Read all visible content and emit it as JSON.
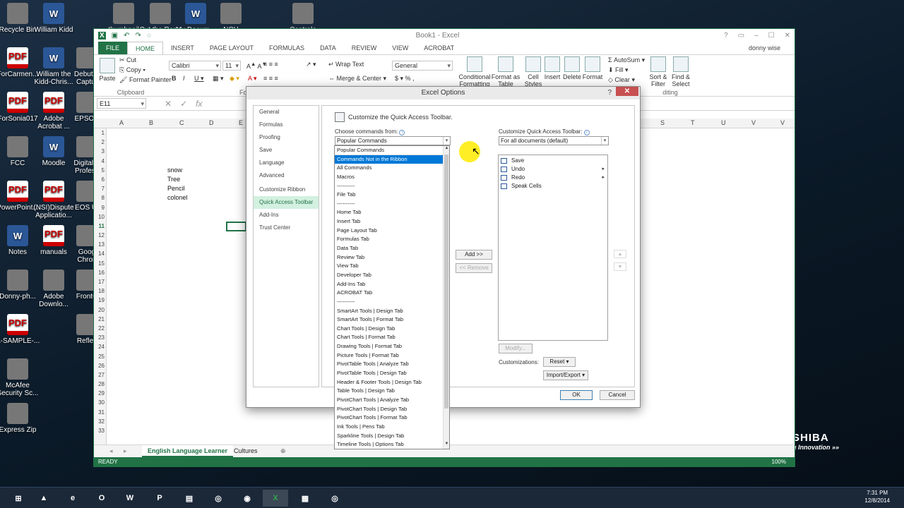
{
  "desktop": {
    "icons_left": [
      {
        "label": "Recycle Bin",
        "icon": "recycle-bin-icon"
      },
      {
        "label": "ForCarmen...",
        "icon": "pdf-icon"
      },
      {
        "label": "ForSonia017",
        "icon": "pdf-icon"
      },
      {
        "label": "FCC",
        "icon": "settings-icon"
      },
      {
        "label": "PowerPoint...",
        "icon": "pdf-icon"
      },
      {
        "label": "Notes",
        "icon": "word-icon"
      },
      {
        "label": "Donny-ph...",
        "icon": "image-icon"
      },
      {
        "label": "A-SAMPLE-...",
        "icon": "pdf-icon"
      },
      {
        "label": "McAfee",
        "label2": "Security Sc...",
        "icon": "mcafee-icon"
      },
      {
        "label": "Express Zip",
        "icon": "zip-icon"
      }
    ],
    "icons_col2": [
      {
        "label": "William Kidd",
        "icon": "word-icon"
      },
      {
        "label": "William the",
        "label2": "Kidd-Chris...",
        "icon": "word-icon"
      },
      {
        "label": "Adobe",
        "label2": "Acrobat ...",
        "icon": "pdf-icon"
      },
      {
        "label": "Moodle",
        "icon": "word-icon"
      },
      {
        "label": "(NSI)Dispute",
        "label2": "Applicatio...",
        "icon": "pdf-icon"
      },
      {
        "label": "manuals",
        "icon": "pdf-icon"
      },
      {
        "label": "Adobe",
        "label2": "Downlo...",
        "icon": "adobe-icon"
      }
    ],
    "icons_col3": [
      {
        "label": "Debut V",
        "label2": "Captur",
        "icon": "app-icon"
      },
      {
        "label": "EPSON",
        "icon": "printer-icon"
      },
      {
        "label": "Digital P",
        "label2": "Profess",
        "icon": "app-icon"
      },
      {
        "label": "EOS Ut",
        "icon": "camera-icon"
      },
      {
        "label": "Goog",
        "label2": "Chron",
        "icon": "chrome-icon"
      },
      {
        "label": "FrontC",
        "icon": "app-icon"
      },
      {
        "label": "Reflec",
        "icon": "app-icon"
      }
    ],
    "icons_top": [
      {
        "label": "thumbnail",
        "icon": "app-icon"
      },
      {
        "label": "Cut the Rope",
        "icon": "game-icon"
      },
      {
        "label": "My Docum...",
        "icon": "word-icon"
      },
      {
        "label": "NCH",
        "icon": "app-icon"
      },
      {
        "label": "Centrale",
        "icon": "app-icon"
      }
    ],
    "toshiba": {
      "brand": "SHIBA",
      "tagline": "g Innovation »»"
    }
  },
  "excel": {
    "title": "Book1 - Excel",
    "user": "donny wise",
    "tabs": [
      "FILE",
      "HOME",
      "INSERT",
      "PAGE LAYOUT",
      "FORMULAS",
      "DATA",
      "REVIEW",
      "VIEW",
      "ACROBAT"
    ],
    "ribbon": {
      "paste": "Paste",
      "cut": "Cut",
      "copy": "Copy",
      "format_painter": "Format Painter",
      "clipboard": "Clipboard",
      "font_name": "Calibri",
      "font_size": "11",
      "font_group": "Font",
      "wrap_text": "Wrap Text",
      "merge_center": "Merge & Center",
      "number_format": "General",
      "conditional_formatting": "Conditional Formatting",
      "format_as_table": "Format as Table",
      "cell_styles": "Cell Styles",
      "insert": "Insert",
      "delete": "Delete",
      "format": "Format",
      "autosum": "AutoSum",
      "fill": "Fill",
      "clear": "Clear",
      "sort_filter": "Sort & Filter",
      "find_select": "Find & Select",
      "editing": "diting"
    },
    "name_box": "E11",
    "columns": [
      "A",
      "B",
      "C",
      "D",
      "E"
    ],
    "columns_right": [
      "S",
      "T",
      "U",
      "V",
      "V"
    ],
    "rows": [
      "1",
      "2",
      "3",
      "4",
      "5",
      "6",
      "7",
      "8",
      "9",
      "10",
      "11",
      "12",
      "13",
      "14",
      "15",
      "16",
      "17",
      "18",
      "19",
      "20",
      "21",
      "22",
      "23",
      "24",
      "25",
      "26",
      "27",
      "28",
      "29",
      "30",
      "31",
      "32",
      "33"
    ],
    "cells": [
      "snow",
      "Tree",
      "Pencil",
      "colonel"
    ],
    "sheet_tabs": [
      "English Language Learner",
      "Cultures"
    ],
    "status": "READY",
    "zoom": "100%"
  },
  "dialog": {
    "title": "Excel Options",
    "help": "?",
    "close": "✕",
    "nav": [
      "General",
      "Formulas",
      "Proofing",
      "Save",
      "Language",
      "Advanced",
      "Customize Ribbon",
      "Quick Access Toolbar",
      "Add-Ins",
      "Trust Center"
    ],
    "nav_selected": "Quick Access Toolbar",
    "heading": "Customize the Quick Access Toolbar.",
    "choose_label": "Choose commands from:",
    "choose_value": "Popular Commands",
    "customize_label": "Customize Quick Access Toolbar:",
    "customize_value": "For all documents (default)",
    "dropdown_options": [
      "Popular Commands",
      "Commands Not in the Ribbon",
      "All Commands",
      "Macros",
      "----------",
      "File Tab",
      "----------",
      "Home Tab",
      "Insert Tab",
      "Page Layout Tab",
      "Formulas Tab",
      "Data Tab",
      "Review Tab",
      "View Tab",
      "Developer Tab",
      "Add-Ins Tab",
      "ACROBAT Tab",
      "----------",
      "SmartArt Tools | Design Tab",
      "SmartArt Tools | Format Tab",
      "Chart Tools | Design Tab",
      "Chart Tools | Format Tab",
      "Drawing Tools | Format Tab",
      "Picture Tools | Format Tab",
      "PivotTable Tools | Analyze Tab",
      "PivotTable Tools | Design Tab",
      "Header & Footer Tools | Design Tab",
      "Table Tools | Design Tab",
      "PivotChart Tools | Analyze Tab",
      "PivotChart Tools | Design Tab",
      "PivotChart Tools | Format Tab",
      "Ink Tools | Pens Tab",
      "Sparkline Tools | Design Tab",
      "Timeline Tools | Options Tab"
    ],
    "highlighted_option": "Commands Not in the Ribbon",
    "qat_items": [
      {
        "label": "Save",
        "has_sub": false
      },
      {
        "label": "Undo",
        "has_sub": true
      },
      {
        "label": "Redo",
        "has_sub": true
      },
      {
        "label": "Speak Cells",
        "has_sub": false
      }
    ],
    "add_button": "Add >>",
    "remove_button": "<< Remove",
    "modify_button": "Modify...",
    "customizations_label": "Customizations:",
    "reset_button": "Reset ▾",
    "import_export_button": "Import/Export ▾",
    "ok_button": "OK",
    "cancel_button": "Cancel"
  },
  "taskbar": {
    "time": "7:31 PM",
    "date": "12/8/2014",
    "apps": [
      "windows-icon",
      "google-drive-icon",
      "ie-icon",
      "outlook-icon",
      "word-icon",
      "powerpoint-icon",
      "file-explorer-icon",
      "app-icon",
      "chrome-icon",
      "excel-icon",
      "calculator-icon",
      "app-icon"
    ]
  }
}
